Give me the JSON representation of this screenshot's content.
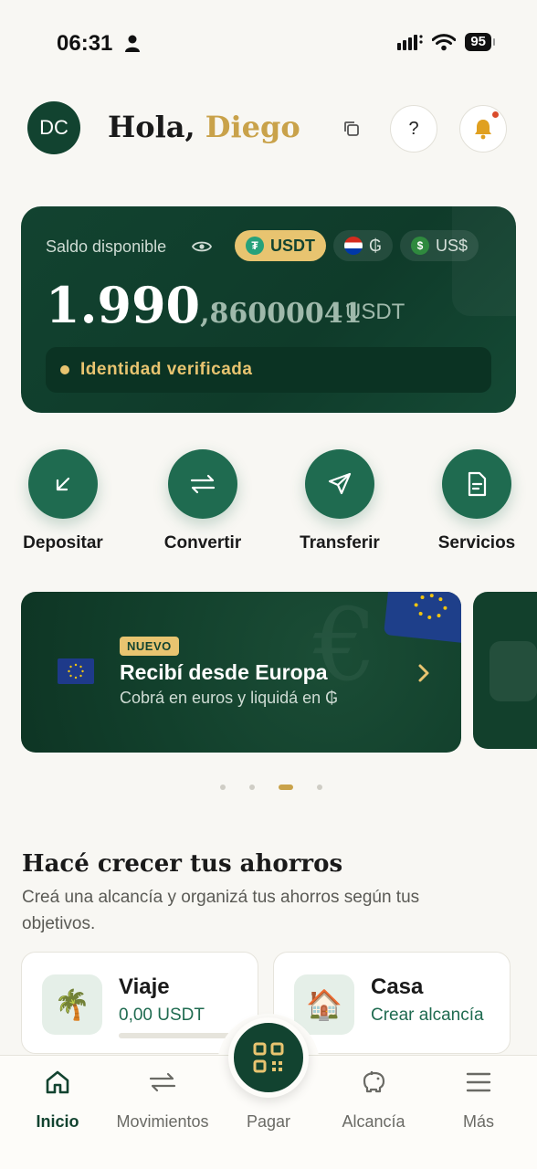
{
  "status_bar": {
    "time": "06:31",
    "battery": "95"
  },
  "header": {
    "avatar_initials": "DC",
    "greeting": "Hola,",
    "user_name": "Diego",
    "help_label": "?"
  },
  "balance": {
    "label": "Saldo disponible",
    "currencies": [
      {
        "label": "USDT",
        "active": true
      },
      {
        "label": "₲",
        "active": false
      },
      {
        "label": "US$",
        "active": false
      }
    ],
    "amount_integer": "1.990",
    "amount_decimal": ",86000041",
    "amount_currency": "USDT",
    "verification_text": "Identidad verificada"
  },
  "actions": [
    {
      "label": "Depositar",
      "icon": "deposit-arrow-icon"
    },
    {
      "label": "Convertir",
      "icon": "swap-arrows-icon"
    },
    {
      "label": "Transferir",
      "icon": "send-plane-icon"
    },
    {
      "label": "Servicios",
      "icon": "document-icon"
    }
  ],
  "promo": {
    "badge": "NUEVO",
    "title": "Recibí desde Europa",
    "subtitle": "Cobrá en euros y liquidá en ₲",
    "carousel_total": 4,
    "carousel_active": 3
  },
  "savings": {
    "title": "Hacé crecer tus ahorros",
    "description": "Creá una alcancía y organizá tus ahorros según tus objetivos.",
    "goals": [
      {
        "name": "Viaje",
        "subtitle": "0,00 USDT",
        "emoji": "🌴"
      },
      {
        "name": "Casa",
        "subtitle": "Crear alcancía",
        "emoji": "🏠"
      }
    ]
  },
  "nav": {
    "items": [
      {
        "label": "Inicio",
        "active": true
      },
      {
        "label": "Movimientos",
        "active": false
      },
      {
        "label": "Pagar",
        "active": false
      },
      {
        "label": "Alcancía",
        "active": false
      },
      {
        "label": "Más",
        "active": false
      }
    ]
  },
  "colors": {
    "brand_green": "#124330",
    "action_green": "#1f6b50",
    "accent_gold": "#c9a24a",
    "pill_gold": "#e8c470"
  }
}
